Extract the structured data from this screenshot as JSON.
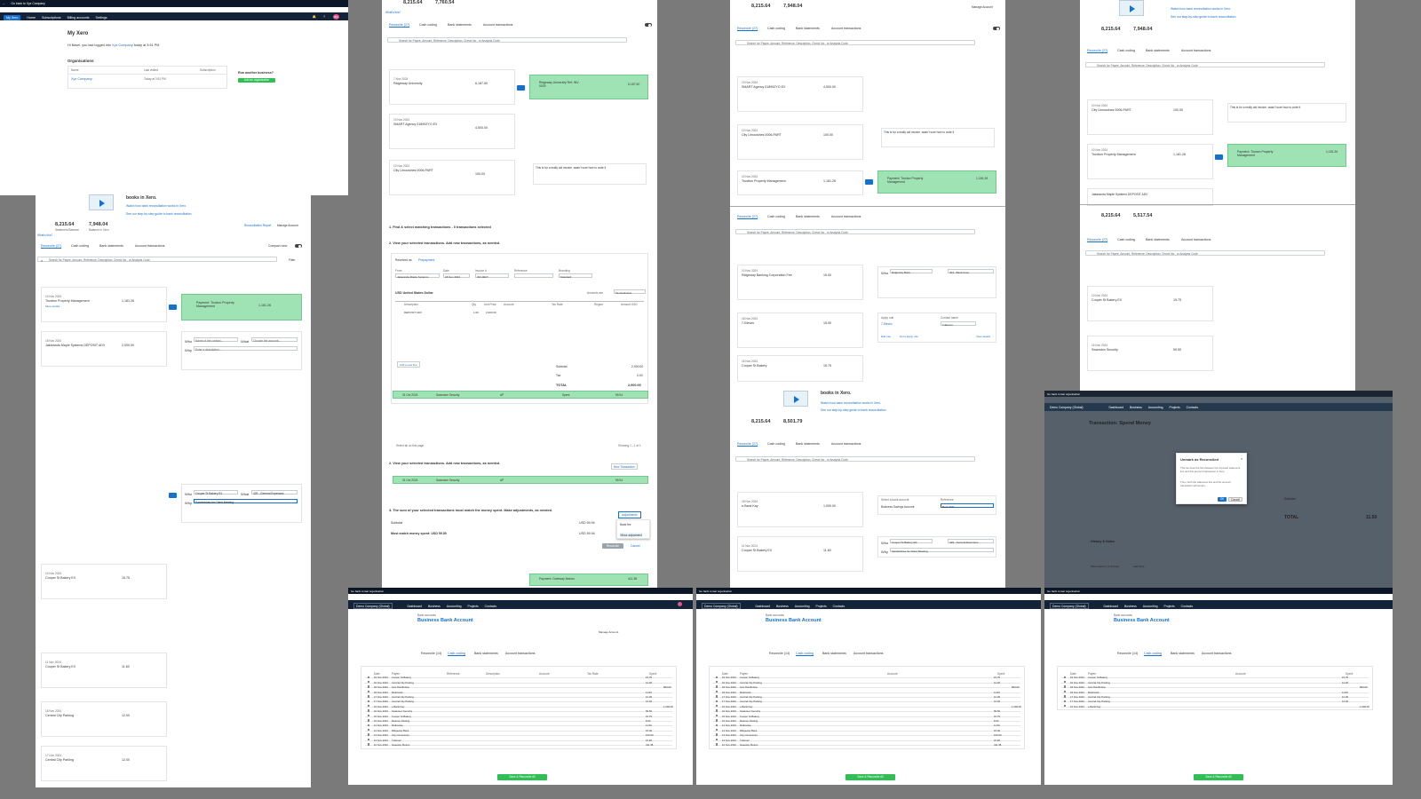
{
  "tl": {
    "back": "Go back to Xyz Company",
    "brand": "My Xero",
    "nav": [
      "Home",
      "Subscriptions",
      "Billing accounts",
      "Settings"
    ],
    "avatar": "BN",
    "title": "My Xero",
    "greet": "Hi Basel, you last logged into ",
    "company": "Xyz Company",
    "greet_tail": " today at 3:51 PM",
    "orgs": "Organisations",
    "col_name": "Name",
    "col_last": "Last visited",
    "col_sub": "Subscription",
    "org_name": "Xyz Company",
    "org_last": "Today at 3:51 PM",
    "run": "Run another business?",
    "add_org": "Add an organisation"
  },
  "rec": {
    "stmt1": "8,215.64",
    "stmt1b": "7,948.04",
    "stmt2": "7,760.54",
    "stmt3": "5,517.54",
    "stmt4": "8,501.79",
    "stmt_lbl": "Statement Balance",
    "xero_lbl": "Balance in Xero",
    "tabs": [
      "Reconcile (27)",
      "Cash coding",
      "Bank statements",
      "Account transactions"
    ],
    "compact": "Compact view",
    "search_ph": "Search for Payee, Amount, Reference, Description, Check No., or Analysis Code",
    "filter": "Filter",
    "whats": "What's this?",
    "review": "Review your bank statement lines...",
    "then": "...then match with your transactions in Xero",
    "options": "Options",
    "spent": "Spent",
    "received": "Received",
    "ok": "OK",
    "actions": [
      "Match",
      "Create",
      "Transfer",
      "Discuss"
    ],
    "find": "Find & Match",
    "who": "Who",
    "what": "What",
    "why": "Why",
    "region": "Region",
    "tax": "Tax Rate",
    "add_details": "Add details",
    "name_ph": "Name of the contact...",
    "acct_ph": "Choose the account...",
    "desc_ph": "Enter a description...",
    "more": "More details",
    "mgr": "Manage Account",
    "recon_rpt": "Reconciliation Report",
    "books": "books in Xero.",
    "watch": "Watch how bank reconciliation works in Xero.",
    "guide": "See our step-by-step guide to bank reconciliation",
    "discuss_txt": "This is for a really old invoice, wasn't sure how to code it"
  },
  "lines": [
    {
      "date": "10 Nov 2024",
      "payee": "Trustton Property Management",
      "amt": "1,181.26",
      "match": "Payment: Truston Property Management"
    },
    {
      "date": "18 Nov 2024",
      "payee": "Jakaranda Maple Systems DEPOSIT ADV",
      "amt": "2,000.00"
    },
    {
      "date": "10 Nov 2024",
      "payee": "Ridgeway Bank",
      "amt": "15.00",
      "acct": "404 - Bank Fees"
    },
    {
      "date": "10 Nov 2024",
      "payee": "Cooper St Bakery EX",
      "amt": "15.75",
      "acct": "429 - General Expenses",
      "why": "Sandwiches for Client Meeting"
    },
    {
      "date": "16 Nov 2024",
      "payee": "Swanston Security",
      "amt": "59.50"
    },
    {
      "date": "11 Nov 2024",
      "payee": "Cooper St Bakery EX",
      "amt": "11.60",
      "acct": "429 - General Expenses",
      "why": "Sandwiches for Client Meeting"
    },
    {
      "date": "18 Nov 2024",
      "payee": "Central City Parking",
      "amt": "12.00"
    },
    {
      "date": "17 Nov 2024",
      "payee": "Central City Parking",
      "amt": "12.00"
    },
    {
      "date": "7 Nov 2024",
      "payee": "Ridgeway University",
      "amt": "6,187.50",
      "match": "Ridgeway University Ref: INV-0029"
    },
    {
      "date": "19 Nov 2024",
      "payee": "SMART Agency 01899ZYO EX",
      "amt": "4,500.00"
    },
    {
      "date": "10 Nov 2024",
      "payee": "City Limousines 0006-PART",
      "amt": "100.00"
    },
    {
      "date": "10 Nov 2024",
      "payee": "Ridgeway Banking Corporation Fee",
      "amt": "15.00"
    },
    {
      "date": "18 Nov 2024",
      "payee": "7-Eleven",
      "amt": "15.90"
    },
    {
      "date": "16 Nov 2024",
      "payee": "Cooper St Bakery",
      "amt": "15.75"
    },
    {
      "date": "18 Nov 2024",
      "payee": "e-Bank Kay",
      "amt": "1,000.00"
    },
    {
      "date": "19 Nov 2024",
      "payee": "Gateway Motors",
      "amt": "411.38",
      "match": "Payment: Gateway Motors"
    }
  ],
  "fm": {
    "step1": "1. Find & select matching transactions - 0 transactions selected",
    "step2": "2. View your selected transactions. Add new transactions, as needed.",
    "recv_as": "Received as",
    "prepay": "Prepayment",
    "from": "From",
    "from_val": "Jakaranda Maple Systems",
    "date": "Date",
    "date_val": "18 Nov 2024",
    "invno": "Invoice #",
    "invno_val": "INV-0027",
    "ref": "Reference",
    "branding": "Branding",
    "brand_val": "Standard",
    "currency": "USD United States Dollar",
    "amounts_are": "Amounts are",
    "tax_excl": "Tax Exclusive",
    "cols": [
      "Description",
      "Qty",
      "Unit Price",
      "Account",
      "Tax Rate",
      "Region",
      "Amount USD"
    ],
    "item": "DEPOSIT ADV",
    "qty": "1.00",
    "price": "2,000.00",
    "add_line": "Add a new line",
    "subtotal": "Subtotal",
    "sub_val": "2,000.00",
    "tax": "Tax",
    "tax_val": "0.00",
    "total": "TOTAL",
    "total_val": "2,000.00",
    "sel_date": "31 Oct 2024",
    "sel_name": "Swanston Security",
    "sel_type": "AP",
    "sel_spent": "Spent",
    "sel_amt": "59.94",
    "sel_cur": "USD",
    "sel_all": "Select all on this page",
    "showing": "Showing 1 - 1 of 1",
    "new_txn": "New Transaction",
    "step3": "3. The sum of your selected transactions must match the money spent. Make adjustments, as needed.",
    "subtotal3": "Subtotal",
    "sub3": "USD 59.94",
    "must": "Must match money spent: USD 59.50",
    "total_short": "Total is out by",
    "adjust": "Adjustments",
    "adj_opts": [
      "Bank fee",
      "Minor adjustment"
    ],
    "reconcile": "Reconcile",
    "cancel": "Cancel"
  },
  "tfr": {
    "sel_bank": "Select a bank account",
    "bank": "Business Savings Account",
    "ref": "Reference",
    "ref_val": "Bank TRF",
    "apply_rule": "Apply rule",
    "contact_name": "Contact name",
    "rule_7": "7-Eleven",
    "edit_rule": "Edit rule",
    "dont": "Don't apply rule",
    "view": "View details"
  },
  "dlg": {
    "back": "Go back to last organisation",
    "org": "Demo Company (Global)",
    "nav": [
      "Dashboard",
      "Business",
      "Accounting",
      "Projects",
      "Contacts"
    ],
    "title": "Transaction: Spend Money",
    "dlg_title": "Unmark as Reconciled",
    "dlg_body": "This removes the link between the imported statement line and this account transaction in Xero.",
    "dlg_body2": "Then, both the statement line and the account transaction will remain.",
    "ok": "OK",
    "cancel": "Cancel",
    "subtotal": "Subtotal",
    "total": "TOTAL",
    "total_val": "11.50",
    "tbl_total": "11.50",
    "history": "History & Notes",
    "show_history": "Show History (3 entries)",
    "add_note": "Add Note",
    "tax_excl": "Tax Exclusive"
  },
  "cc": {
    "org": "Demo Company (Global)",
    "nav": [
      "Dashboard",
      "Business",
      "Accounting",
      "Projects",
      "Contacts"
    ],
    "crumb": "Bank accounts",
    "acct": "Business Bank Account",
    "acct_sub": "Account",
    "tabs": [
      "Reconcile (14)",
      "Cash coding",
      "Bank statements",
      "Account transactions"
    ],
    "save": "Save & Reconcile All",
    "cols": [
      "Date",
      "Payee",
      "Reference",
      "Description",
      "Account",
      "Tax Rate",
      "Region",
      "Spent",
      "Received"
    ],
    "rows": [
      {
        "d": "19 Nov 2024",
        "p": "Cooper St Bakery",
        "s": "15.75"
      },
      {
        "d": "19 Nov 2024",
        "p": "Central City Parking",
        "s": "12.00"
      },
      {
        "d": "18 Nov 2024",
        "p": "ACL Distribution",
        "r": "500.00"
      },
      {
        "d": "18 Nov 2024",
        "p": "Mellovista",
        "s": "11.60"
      },
      {
        "d": "17 Nov 2024",
        "p": "Central City Parking",
        "s": "12.00"
      },
      {
        "d": "17 Nov 2024",
        "p": "Central City Parking",
        "s": "12.00"
      },
      {
        "d": "16 Nov 2024",
        "p": "e-Bank Kay",
        "r": "1,000.00"
      },
      {
        "d": "16 Nov 2024",
        "p": "Swanston Security",
        "s": "59.50"
      },
      {
        "d": "15 Nov 2024",
        "p": "Cooper St Bakery",
        "s": "15.75"
      },
      {
        "d": "15 Nov 2024",
        "p": "Melrose Parking",
        "s": "8.00"
      },
      {
        "d": "14 Nov 2024",
        "p": "Mellovista",
        "s": "11.60"
      },
      {
        "d": "14 Nov 2024",
        "p": "Ridgeway Bank",
        "s": "15.00"
      },
      {
        "d": "13 Nov 2024",
        "p": "City Limousines",
        "s": "100.00"
      },
      {
        "d": "13 Nov 2024",
        "p": "7-Eleven",
        "s": "15.90"
      },
      {
        "d": "12 Nov 2024",
        "p": "Gateway Motors",
        "s": "411.38"
      }
    ]
  }
}
